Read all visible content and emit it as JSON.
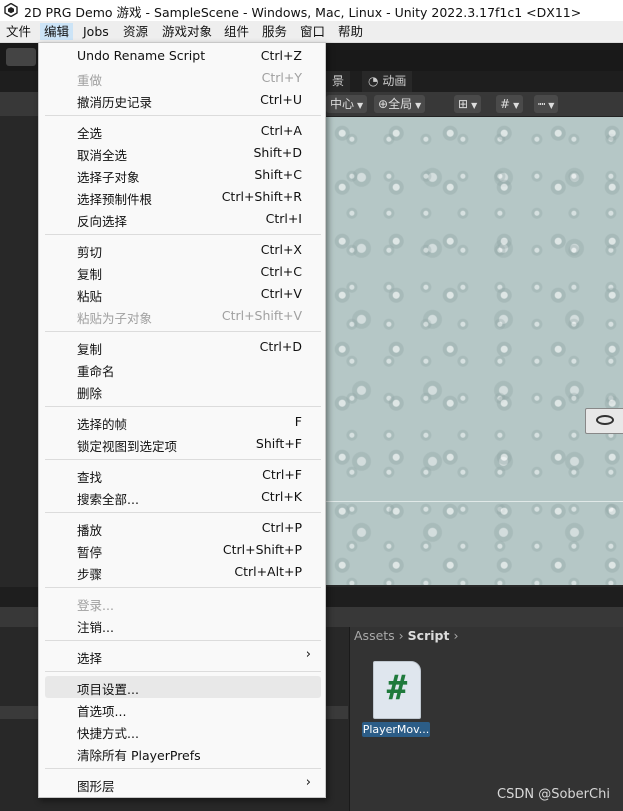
{
  "window": {
    "title": "2D PRG Demo 游戏 - SampleScene - Windows, Mac, Linux - Unity 2022.3.17f1c1 <DX11>"
  },
  "menubar": [
    "文件",
    "编辑",
    "Jobs",
    "资源",
    "游戏对象",
    "组件",
    "服务",
    "窗口",
    "帮助"
  ],
  "scene": {
    "tab_label": "景",
    "anim_tab_label": "动画",
    "pivot_label": "中心",
    "global_label": "全局"
  },
  "edit_menu": {
    "items": [
      {
        "label": "Undo Rename Script",
        "shortcut": "Ctrl+Z"
      },
      {
        "label": "重做",
        "shortcut": "Ctrl+Y",
        "disabled": true
      },
      {
        "label": "撤消历史记录",
        "shortcut": "Ctrl+U"
      },
      {
        "label": "全选",
        "shortcut": "Ctrl+A"
      },
      {
        "label": "取消全选",
        "shortcut": "Shift+D"
      },
      {
        "label": "选择子对象",
        "shortcut": "Shift+C"
      },
      {
        "label": "选择预制件根",
        "shortcut": "Ctrl+Shift+R"
      },
      {
        "label": "反向选择",
        "shortcut": "Ctrl+I"
      },
      {
        "label": "剪切",
        "shortcut": "Ctrl+X"
      },
      {
        "label": "复制",
        "shortcut": "Ctrl+C"
      },
      {
        "label": "粘贴",
        "shortcut": "Ctrl+V"
      },
      {
        "label": "粘贴为子对象",
        "shortcut": "Ctrl+Shift+V",
        "disabled": true
      },
      {
        "label": "复制",
        "shortcut": "Ctrl+D"
      },
      {
        "label": "重命名",
        "shortcut": ""
      },
      {
        "label": "删除",
        "shortcut": ""
      },
      {
        "label": "选择的帧",
        "shortcut": "F"
      },
      {
        "label": "锁定视图到选定项",
        "shortcut": "Shift+F"
      },
      {
        "label": "查找",
        "shortcut": "Ctrl+F"
      },
      {
        "label": "搜索全部...",
        "shortcut": "Ctrl+K"
      },
      {
        "label": "播放",
        "shortcut": "Ctrl+P"
      },
      {
        "label": "暂停",
        "shortcut": "Ctrl+Shift+P"
      },
      {
        "label": "步骤",
        "shortcut": "Ctrl+Alt+P"
      },
      {
        "label": "登录...",
        "shortcut": "",
        "disabled": true
      },
      {
        "label": "注销...",
        "shortcut": ""
      },
      {
        "label": "选择",
        "shortcut": "",
        "submenu": true
      },
      {
        "label": "项目设置...",
        "shortcut": "",
        "highlighted": true
      },
      {
        "label": "首选项...",
        "shortcut": ""
      },
      {
        "label": "快捷方式...",
        "shortcut": ""
      },
      {
        "label": "清除所有 PlayerPrefs",
        "shortcut": ""
      },
      {
        "label": "图形层",
        "shortcut": "",
        "submenu": true
      }
    ]
  },
  "project": {
    "breadcrumb": [
      "Assets",
      "Script"
    ],
    "asset_name": "PlayerMov...",
    "script_glyph": "#"
  },
  "watermark": "CSDN @SoberChi"
}
